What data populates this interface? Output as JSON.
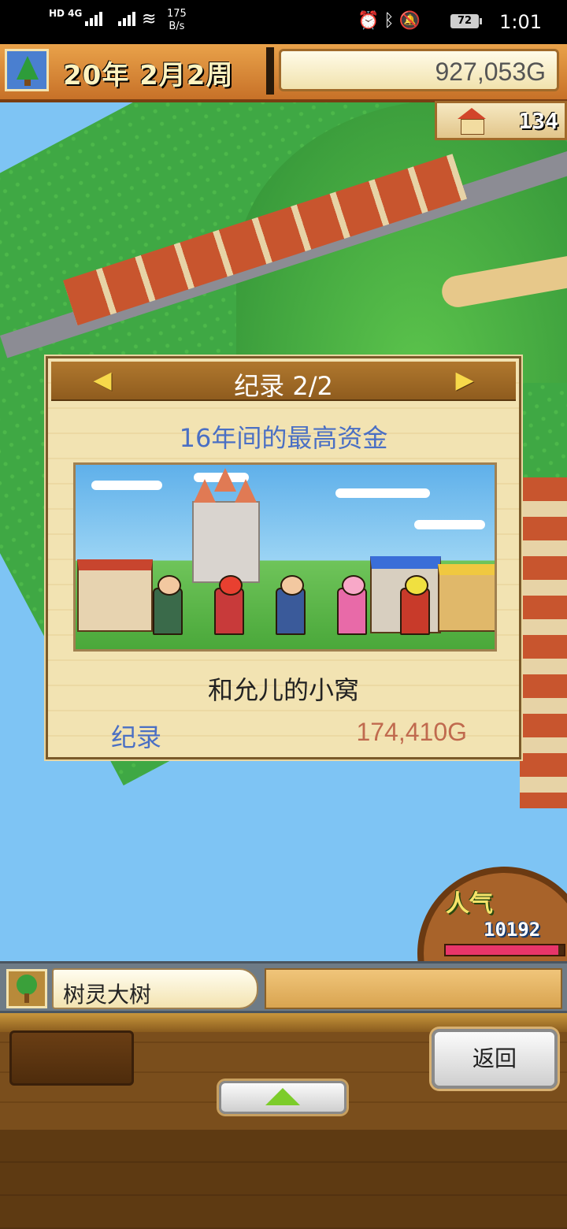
{
  "status_bar": {
    "network": "HD 4G",
    "speed_value": "175",
    "speed_unit": "B/s",
    "battery": "72",
    "time": "1:01"
  },
  "header": {
    "date": "20年 2月2周",
    "funds": "927,053G",
    "population": "134",
    "season_icon": "christmas-tree-icon",
    "population_icon": "house-icon"
  },
  "dialog": {
    "title": "纪录 2/2",
    "subtitle": "16年间的最高资金",
    "house_name": "和允儿的小窝",
    "record_label": "纪录",
    "record_value": "174,410G"
  },
  "popularity": {
    "label": "人气",
    "value": "10192",
    "meter_fraction": 0.95
  },
  "info_bar": {
    "selected_name": "树灵大树",
    "selected_icon": "tree-icon"
  },
  "controls": {
    "back_label": "返回",
    "expand_icon": "up-arrow-icon"
  },
  "colors": {
    "accent_blue": "#4a6fc4",
    "record_value": "#c06a4e",
    "panel_wood": "#7a4e1c"
  }
}
